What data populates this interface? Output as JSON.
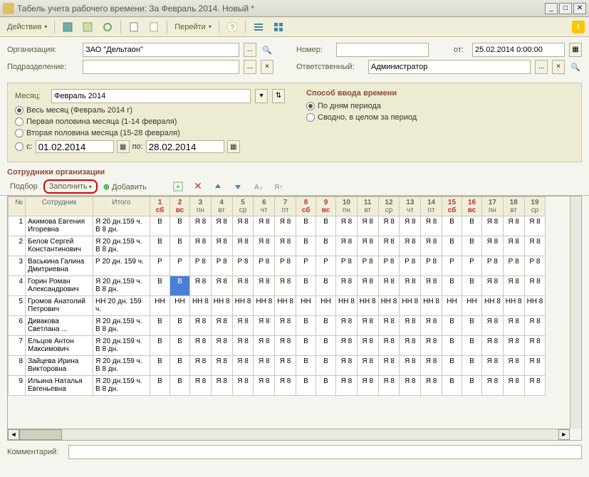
{
  "title": "Табель учета рабочего времени: За Февраль 2014. Новый *",
  "toolbar": {
    "actions": "Действия",
    "go": "Перейти"
  },
  "labels": {
    "org": "Организация:",
    "dept": "Подразделение:",
    "num": "Номер:",
    "from": "от:",
    "resp": "Ответственный:",
    "month": "Месяц:",
    "method": "Способ ввода времени",
    "whole": "Весь месяц (Февраль 2014 г)",
    "first_half": "Первая половина месяца (1-14 февраля)",
    "second_half": "Вторая половина месяца (15-28 февраля)",
    "c": "с:",
    "po": "по:",
    "by_days": "По дням периода",
    "summary": "Сводно, в целом за период",
    "employees": "Сотрудники организации",
    "select": "Подбор",
    "fill": "Заполнить",
    "add": "Добавить",
    "comment": "Комментарий:",
    "num_col": "№",
    "emp_col": "Сотрудник",
    "itogo": "Итого"
  },
  "values": {
    "org": "ЗАО \"Дельтаон\"",
    "dept": "",
    "num": "",
    "from": "25.02.2014 0:00:00",
    "resp": "Администратор",
    "month": "Февраль 2014",
    "date_from": "01.02.2014",
    "date_to": "28.02.2014",
    "comment": ""
  },
  "days": [
    {
      "n": "1",
      "w": "сб",
      "wk": true
    },
    {
      "n": "2",
      "w": "вс",
      "wk": true
    },
    {
      "n": "3",
      "w": "пн"
    },
    {
      "n": "4",
      "w": "вт"
    },
    {
      "n": "5",
      "w": "ср"
    },
    {
      "n": "6",
      "w": "чт"
    },
    {
      "n": "7",
      "w": "пт"
    },
    {
      "n": "8",
      "w": "сб",
      "wk": true
    },
    {
      "n": "9",
      "w": "вс",
      "wk": true
    },
    {
      "n": "10",
      "w": "пн"
    },
    {
      "n": "11",
      "w": "вт"
    },
    {
      "n": "12",
      "w": "ср"
    },
    {
      "n": "13",
      "w": "чт"
    },
    {
      "n": "14",
      "w": "пт"
    },
    {
      "n": "15",
      "w": "сб",
      "wk": true
    },
    {
      "n": "16",
      "w": "вс",
      "wk": true
    },
    {
      "n": "17",
      "w": "пн"
    },
    {
      "n": "18",
      "w": "вт"
    },
    {
      "n": "19",
      "w": "ср"
    }
  ],
  "rows": [
    {
      "n": 1,
      "name": "Акимова Евгения Игоревна",
      "itogo": "Я 20 дн.159 ч. В 8 дн.",
      "cells": [
        "В",
        "В",
        "Я 8",
        "Я 8",
        "Я 8",
        "Я 8",
        "Я 8",
        "В",
        "В",
        "Я 8",
        "Я 8",
        "Я 8",
        "Я 8",
        "Я 8",
        "В",
        "В",
        "Я 8",
        "Я 8",
        "Я 8"
      ]
    },
    {
      "n": 2,
      "name": "Белов Сергей Константинович",
      "itogo": "Я 20 дн.159 ч. В 8 дн.",
      "cells": [
        "В",
        "В",
        "Я 8",
        "Я 8",
        "Я 8",
        "Я 8",
        "Я 8",
        "В",
        "В",
        "Я 8",
        "Я 8",
        "Я 8",
        "Я 8",
        "Я 8",
        "В",
        "В",
        "Я 8",
        "Я 8",
        "Я 8"
      ]
    },
    {
      "n": 3,
      "name": "Васькина Галина Дмитриевна",
      "itogo": "Р 20 дн. 159 ч.",
      "cells": [
        "Р",
        "Р",
        "Р 8",
        "Р 8",
        "Р 8",
        "Р 8",
        "Р 8",
        "Р",
        "Р",
        "Р 8",
        "Р 8",
        "Р 8",
        "Р 8",
        "Р 8",
        "Р",
        "Р",
        "Р 8",
        "Р 8",
        "Р 8"
      ]
    },
    {
      "n": 4,
      "name": "Горин Роман Александрович",
      "itogo": "Я 20 дн.159 ч. В 8 дн.",
      "cells": [
        "В",
        "В",
        "Я 8",
        "Я 8",
        "Я 8",
        "Я 8",
        "Я 8",
        "В",
        "В",
        "Я 8",
        "Я 8",
        "Я 8",
        "Я 8",
        "Я 8",
        "В",
        "В",
        "Я 8",
        "Я 8",
        "Я 8"
      ],
      "sel": 1
    },
    {
      "n": 5,
      "name": "Громов Анатолий Петрович",
      "itogo": "НН 20 дн. 159 ч.",
      "cells": [
        "НН",
        "НН",
        "НН 8",
        "НН 8",
        "НН 8",
        "НН 8",
        "НН 8",
        "НН",
        "НН",
        "НН 8",
        "НН 8",
        "НН 8",
        "НН 8",
        "НН 8",
        "НН",
        "НН",
        "НН 8",
        "НН 8",
        "НН 8"
      ]
    },
    {
      "n": 6,
      "name": "Дивакова Светлана ...",
      "itogo": "Я 20 дн.159 ч. В 8 дн.",
      "cells": [
        "В",
        "В",
        "Я 8",
        "Я 8",
        "Я 8",
        "Я 8",
        "Я 8",
        "В",
        "В",
        "Я 8",
        "Я 8",
        "Я 8",
        "Я 8",
        "Я 8",
        "В",
        "В",
        "Я 8",
        "Я 8",
        "Я 8"
      ]
    },
    {
      "n": 7,
      "name": "Ельцов Антон Максимович",
      "itogo": "Я 20 дн.159 ч. В 8 дн.",
      "cells": [
        "В",
        "В",
        "Я 8",
        "Я 8",
        "Я 8",
        "Я 8",
        "Я 8",
        "В",
        "В",
        "Я 8",
        "Я 8",
        "Я 8",
        "Я 8",
        "Я 8",
        "В",
        "В",
        "Я 8",
        "Я 8",
        "Я 8"
      ]
    },
    {
      "n": 8,
      "name": "Зайцева Ирина Викторовна",
      "itogo": "Я 20 дн.159 ч. В 8 дн.",
      "cells": [
        "В",
        "В",
        "Я 8",
        "Я 8",
        "Я 8",
        "Я 8",
        "Я 8",
        "В",
        "В",
        "Я 8",
        "Я 8",
        "Я 8",
        "Я 8",
        "Я 8",
        "В",
        "В",
        "Я 8",
        "Я 8",
        "Я 8"
      ]
    },
    {
      "n": 9,
      "name": "Ильина Наталья Евгеньевна",
      "itogo": "Я 20 дн.159 ч. В 8 дн.",
      "cells": [
        "В",
        "В",
        "Я 8",
        "Я 8",
        "Я 8",
        "Я 8",
        "Я 8",
        "В",
        "В",
        "Я 8",
        "Я 8",
        "Я 8",
        "Я 8",
        "Я 8",
        "В",
        "В",
        "Я 8",
        "Я 8",
        "Я 8"
      ]
    }
  ]
}
